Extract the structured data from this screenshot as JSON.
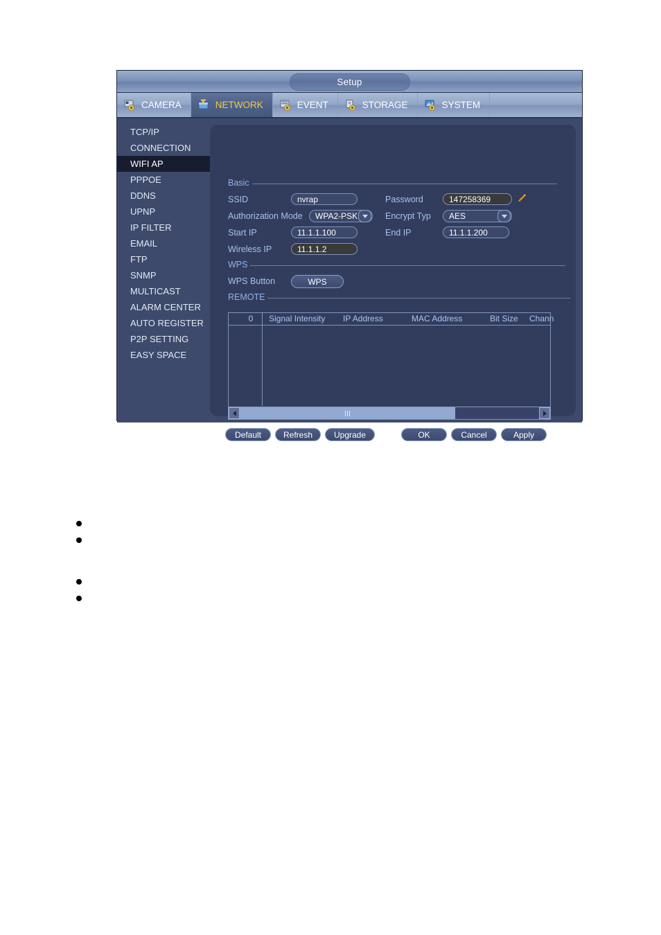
{
  "window": {
    "title": "Setup"
  },
  "tabs": [
    {
      "label": "CAMERA",
      "icon": "camera-gear-icon",
      "active": false
    },
    {
      "label": "NETWORK",
      "icon": "network-gear-icon",
      "active": true
    },
    {
      "label": "EVENT",
      "icon": "event-gear-icon",
      "active": false
    },
    {
      "label": "STORAGE",
      "icon": "storage-gear-icon",
      "active": false
    },
    {
      "label": "SYSTEM",
      "icon": "system-gear-icon",
      "active": false
    }
  ],
  "sidebar": {
    "items": [
      {
        "label": "TCP/IP",
        "active": false
      },
      {
        "label": "CONNECTION",
        "active": false
      },
      {
        "label": "WIFI AP",
        "active": true
      },
      {
        "label": "PPPOE",
        "active": false
      },
      {
        "label": "DDNS",
        "active": false
      },
      {
        "label": "UPNP",
        "active": false
      },
      {
        "label": "IP FILTER",
        "active": false
      },
      {
        "label": "EMAIL",
        "active": false
      },
      {
        "label": "FTP",
        "active": false
      },
      {
        "label": "SNMP",
        "active": false
      },
      {
        "label": "MULTICAST",
        "active": false
      },
      {
        "label": "ALARM CENTER",
        "active": false
      },
      {
        "label": "AUTO REGISTER",
        "active": false
      },
      {
        "label": "P2P SETTING",
        "active": false
      },
      {
        "label": "EASY SPACE",
        "active": false
      }
    ]
  },
  "sections": {
    "basic": "Basic",
    "wps": "WPS",
    "remote": "REMOTE"
  },
  "form": {
    "ssid": {
      "label": "SSID",
      "value": "nvrap"
    },
    "password": {
      "label": "Password",
      "value": "147258369",
      "edit_icon": "pencil-icon"
    },
    "auth_mode": {
      "label": "Authorization Mode",
      "value": "WPA2-PSK"
    },
    "encrypt": {
      "label": "Encrypt Typ",
      "value": "AES"
    },
    "start_ip": {
      "label": "Start IP",
      "value": "11.1.1.100"
    },
    "end_ip": {
      "label": "End IP",
      "value": "11.1.1.200"
    },
    "wireless_ip": {
      "label": "Wireless IP",
      "value": "11.1.1.2"
    },
    "wps_button": {
      "label": "WPS Button",
      "value": "WPS"
    }
  },
  "table": {
    "columns": [
      "0",
      "Signal Intensity",
      "IP Address",
      "MAC Address",
      "Bit Size",
      "Chann"
    ],
    "rows": []
  },
  "buttons": {
    "default": "Default",
    "refresh": "Refresh",
    "upgrade": "Upgrade",
    "ok": "OK",
    "cancel": "Cancel",
    "apply": "Apply"
  },
  "page_bullets": [
    "",
    "",
    "",
    ""
  ],
  "colors": {
    "accent_active_tab_text": "#f4c842",
    "panel_bg": "#323d5e",
    "dialog_bg": "#3d4a6b",
    "sidebar_active_bg": "#171d2e",
    "label_blue": "#a6c2ea",
    "section_blue": "#8fb3e6",
    "readonly_field_bg": "#3a3a3a"
  }
}
